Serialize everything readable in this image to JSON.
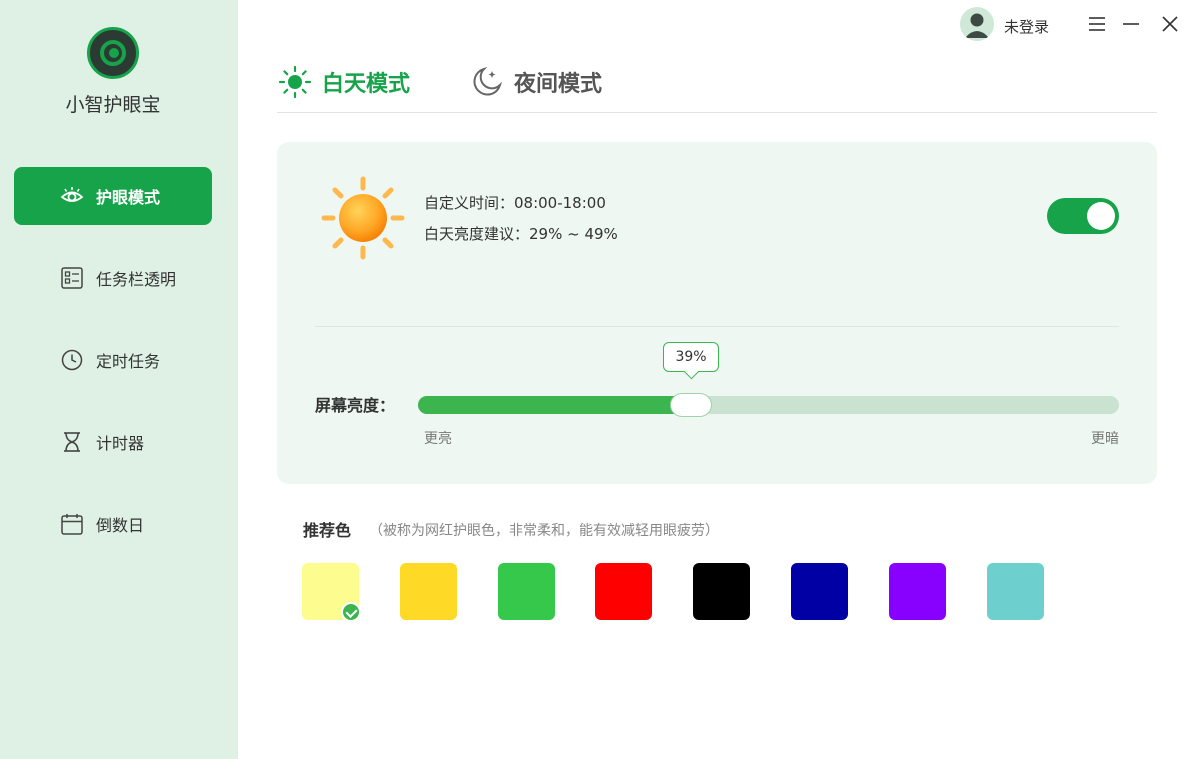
{
  "app": {
    "name": "小智护眼宝"
  },
  "sidebar": {
    "items": [
      {
        "label": "护眼模式",
        "icon": "eye-icon",
        "active": true
      },
      {
        "label": "任务栏透明",
        "icon": "taskbar-icon",
        "active": false
      },
      {
        "label": "定时任务",
        "icon": "clock-icon",
        "active": false
      },
      {
        "label": "计时器",
        "icon": "hourglass-icon",
        "active": false
      },
      {
        "label": "倒数日",
        "icon": "calendar-icon",
        "active": false
      }
    ]
  },
  "topbar": {
    "login_label": "未登录"
  },
  "tabs": [
    {
      "label": "白天模式",
      "icon": "sun-icon",
      "active": true
    },
    {
      "label": "夜间模式",
      "icon": "moon-icon",
      "active": false
    }
  ],
  "day_card": {
    "custom_time": "自定义时间：08:00-18:00",
    "brightness_suggest": "白天亮度建议：29% ~ 49%",
    "toggle_on": true,
    "brightness_label": "屏幕亮度：",
    "brightness_value": 39,
    "brightness_value_text": "39%",
    "scale_left": "更亮",
    "scale_right": "更暗"
  },
  "recommended": {
    "title": "推荐色",
    "note": "（被称为网红护眼色，非常柔和，能有效减轻用眼疲劳）",
    "selected_index": 0,
    "colors": [
      "#fdfc8e",
      "#fed926",
      "#35c84b",
      "#fe0000",
      "#000000",
      "#0000a4",
      "#8800fe",
      "#6dd0ce"
    ]
  },
  "colors": {
    "accent": "#16a34a",
    "sidebar_bg": "#dff1e4",
    "card_bg": "#eef7f1"
  }
}
